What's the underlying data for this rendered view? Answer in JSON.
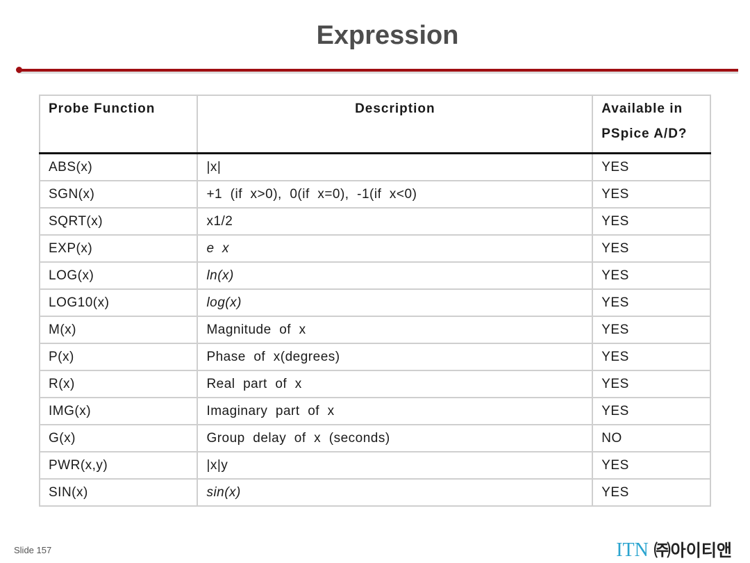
{
  "slide": {
    "title": "Expression",
    "slide_number": "Slide 157",
    "brand_latin": "ITN",
    "brand_korean": "㈜아이티앤",
    "accent_color": "#a00e12",
    "brand_color": "#2aa4cf"
  },
  "table": {
    "headers": {
      "col1": "Probe Function",
      "col2": "Description",
      "col3_line1": "Available in",
      "col3_line2": "PSpice A/D?"
    },
    "rows": [
      {
        "func": "ABS(x)",
        "desc": "|x|",
        "avail": "YES"
      },
      {
        "func": "SGN(x)",
        "desc": "+1  (if  x>0),  0(if  x=0),  -1(if  x<0)",
        "avail": "YES"
      },
      {
        "func": "SQRT(x)",
        "desc": "x1/2",
        "avail": "YES"
      },
      {
        "func": "EXP(x)",
        "desc": "e  x",
        "avail": "YES"
      },
      {
        "func": "LOG(x)",
        "desc": "ln(x)",
        "avail": "YES"
      },
      {
        "func": "LOG10(x)",
        "desc": "log(x)",
        "avail": "YES"
      },
      {
        "func": "M(x)",
        "desc": "Magnitude  of  x",
        "avail": "YES"
      },
      {
        "func": "P(x)",
        "desc": "Phase  of  x(degrees)",
        "avail": "YES"
      },
      {
        "func": "R(x)",
        "desc": "Real  part  of  x",
        "avail": "YES"
      },
      {
        "func": "IMG(x)",
        "desc": "Imaginary  part  of  x",
        "avail": "YES"
      },
      {
        "func": "G(x)",
        "desc": "Group  delay  of  x  (seconds)",
        "avail": "NO"
      },
      {
        "func": "PWR(x,y)",
        "desc": "|x|y",
        "avail": "YES"
      },
      {
        "func": "SIN(x)",
        "desc": "sin(x)",
        "avail": "YES"
      }
    ]
  }
}
